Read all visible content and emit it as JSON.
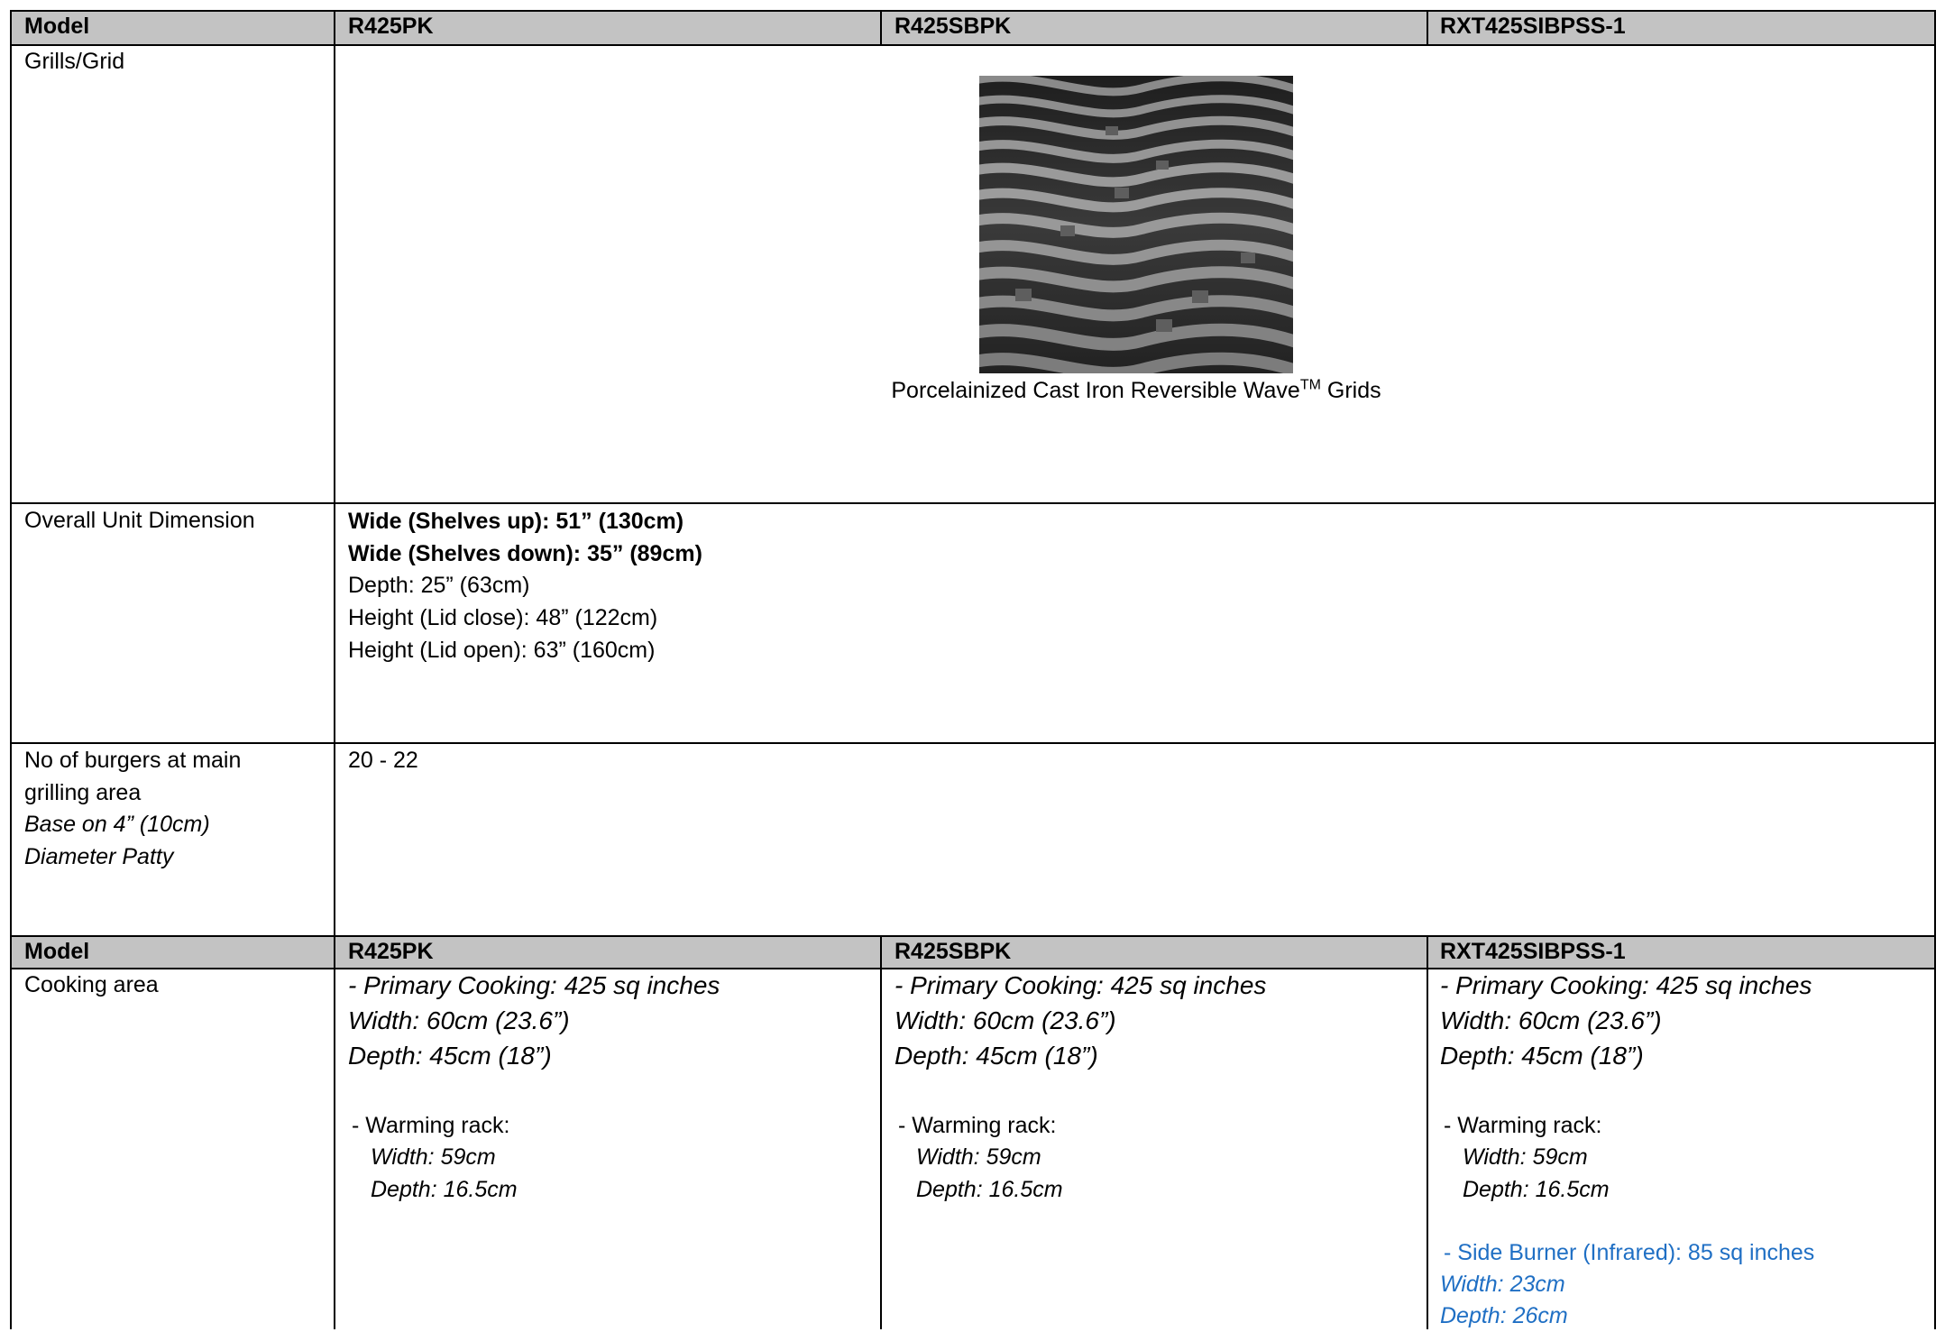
{
  "header_top": {
    "col0": "Model",
    "col1": "R425PK",
    "col2": "R425SBPK",
    "col3": "RXT425SIBPSS-1"
  },
  "grills": {
    "label": "Grills/Grid",
    "caption_main": "Porcelainized Cast Iron Reversible Wave",
    "caption_sup": "TM",
    "caption_end": " Grids"
  },
  "dimension": {
    "label": "Overall Unit Dimension",
    "wide_up": "Wide (Shelves up): 51” (130cm)",
    "wide_down": "Wide (Shelves down): 35” (89cm)",
    "depth": "Depth: 25” (63cm)",
    "height_close": "Height (Lid close): 48” (122cm)",
    "height_open": "Height (Lid open): 63” (160cm)"
  },
  "burgers": {
    "label1": "No of burgers at main",
    "label2": "grilling area",
    "label3": "Base on 4” (10cm)",
    "label4": "Diameter Patty",
    "value": "20 - 22"
  },
  "header_bottom": {
    "col0": "Model",
    "col1": "R425PK",
    "col2": "R425SBPK",
    "col3": "RXT425SIBPSS-1"
  },
  "cooking": {
    "label": "Cooking area",
    "primary": "- Primary Cooking: 425 sq inches",
    "width": "Width: 60cm (23.6”)",
    "depth": "Depth: 45cm (18”)",
    "warming": "- Warming rack:",
    "warm_width": "Width: 59cm",
    "warm_depth": "Depth: 16.5cm",
    "side_burner": "- Side Burner (Infrared): 85 sq inches",
    "side_width": "Width: 23cm",
    "side_depth": "Depth: 26cm",
    "side_color": "#1f6fc4"
  }
}
